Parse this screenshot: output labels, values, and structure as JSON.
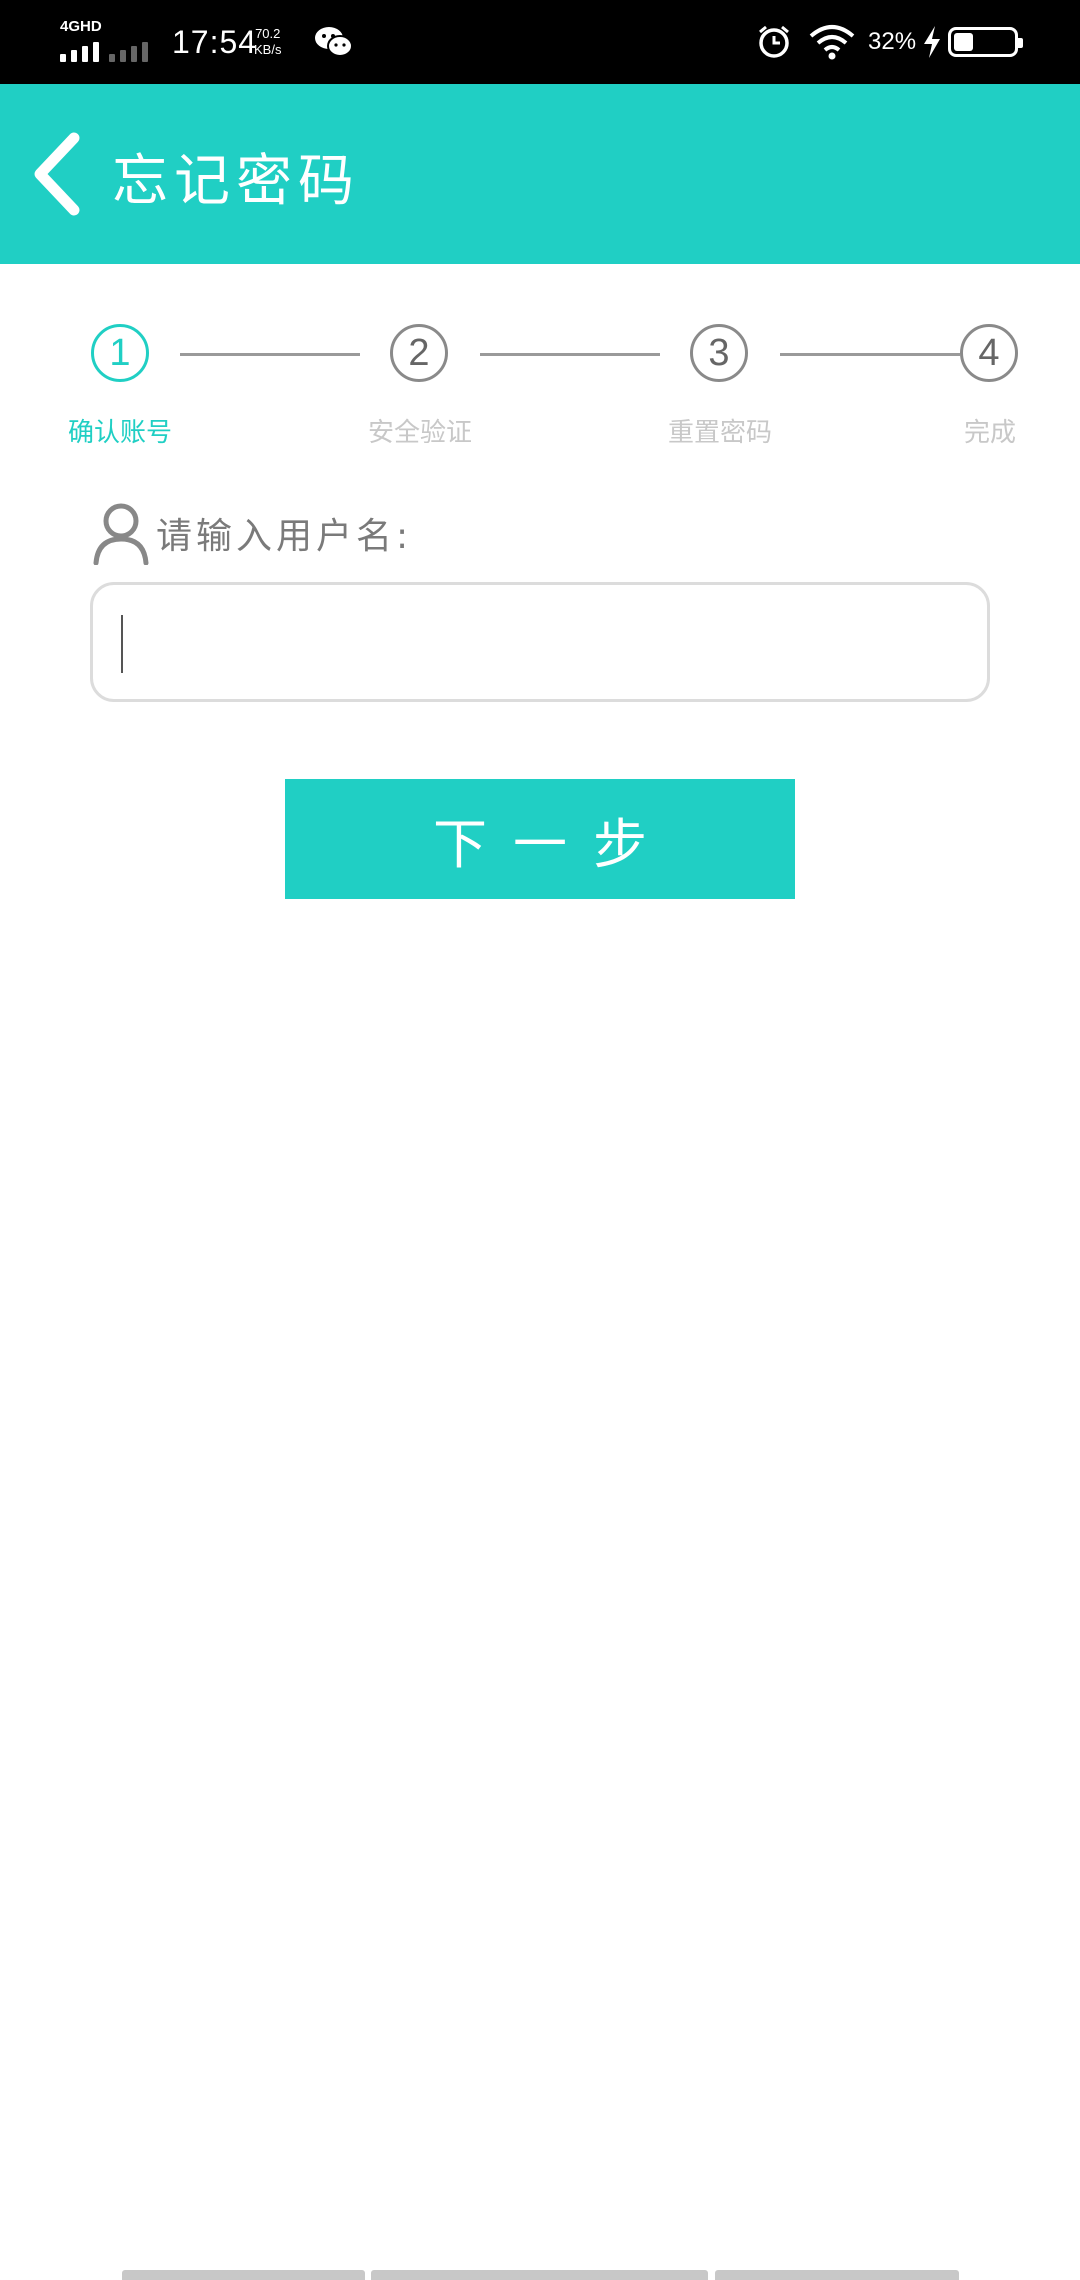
{
  "status_bar": {
    "network": "4GHD",
    "time": "17:54",
    "speed_value": "70.2",
    "speed_unit": "KB/s",
    "battery_text": "32%",
    "battery_level": 0.32,
    "icons": [
      "signal-icon",
      "wechat-icon",
      "alarm-icon",
      "wifi-icon",
      "charging-icon",
      "battery-icon"
    ]
  },
  "header": {
    "title": "忘记密码",
    "back_icon": "chevron-left-icon",
    "background": "#20cfc4"
  },
  "steps": [
    {
      "number": "1",
      "label": "确认账号",
      "active": true
    },
    {
      "number": "2",
      "label": "安全验证",
      "active": false
    },
    {
      "number": "3",
      "label": "重置密码",
      "active": false
    },
    {
      "number": "4",
      "label": "完成",
      "active": false
    }
  ],
  "form": {
    "username_label": "请输入用户名:",
    "username_icon": "user-icon",
    "username_value": ""
  },
  "next_button": {
    "label": "下一步"
  },
  "colors": {
    "accent": "#20cfc4",
    "inactive_label": "#c8c8c8",
    "step_border": "#8a8a8a"
  }
}
